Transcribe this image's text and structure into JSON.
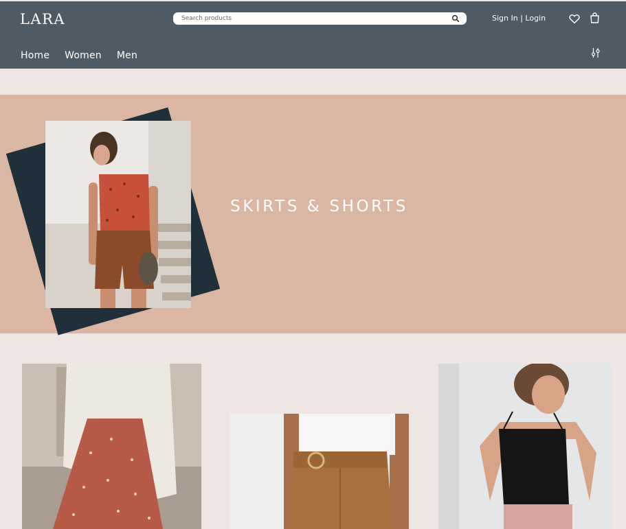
{
  "header": {
    "logo": "LARA",
    "search_placeholder": "Search products",
    "signin_label": "Sign In | Login",
    "nav": [
      "Home",
      "Women",
      "Men"
    ]
  },
  "hero": {
    "title": "SKIRTS & SHORTS"
  },
  "icons": {
    "search": "search-icon",
    "wishlist": "heart-icon",
    "cart": "bag-icon",
    "filter": "filter-icon"
  },
  "colors": {
    "header_bg": "#4f5b64",
    "page_bg": "#efe6e4",
    "hero_bg": "#dbb6a2",
    "hero_accent": "#1f303b"
  }
}
